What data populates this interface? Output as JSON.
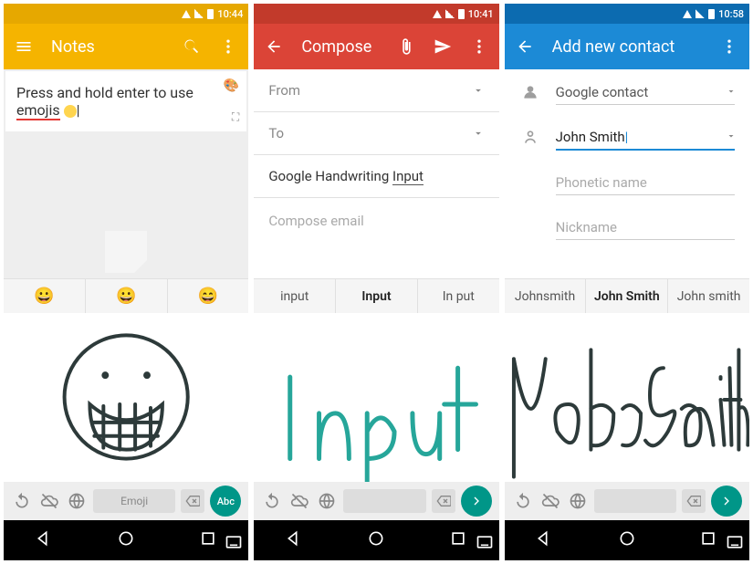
{
  "screens": {
    "notes": {
      "status_time": "10:44",
      "title": "Notes",
      "note_text_a": "Press and hold enter to use",
      "note_text_b": "emojis",
      "cursor": "|",
      "suggestions": [
        "😀",
        "😀",
        "😄"
      ],
      "spacebar_label": "Emoji",
      "action_label": "Abc"
    },
    "gmail": {
      "status_time": "10:41",
      "title": "Compose",
      "from_label": "From",
      "to_label": "To",
      "subject_a": "Google Handwriting ",
      "subject_b": "Input",
      "body_placeholder": "Compose email",
      "suggestions": [
        "input",
        "Input",
        "In put"
      ],
      "spacebar_label": ""
    },
    "contacts": {
      "status_time": "10:58",
      "title": "Add new contact",
      "account_label": "Google contact",
      "name_value": "John Smith",
      "phonetic_placeholder": "Phonetic name",
      "nickname_placeholder": "Nickname",
      "suggestions": [
        "Johnsmith",
        "John Smith",
        "John smith"
      ],
      "spacebar_label": ""
    }
  }
}
